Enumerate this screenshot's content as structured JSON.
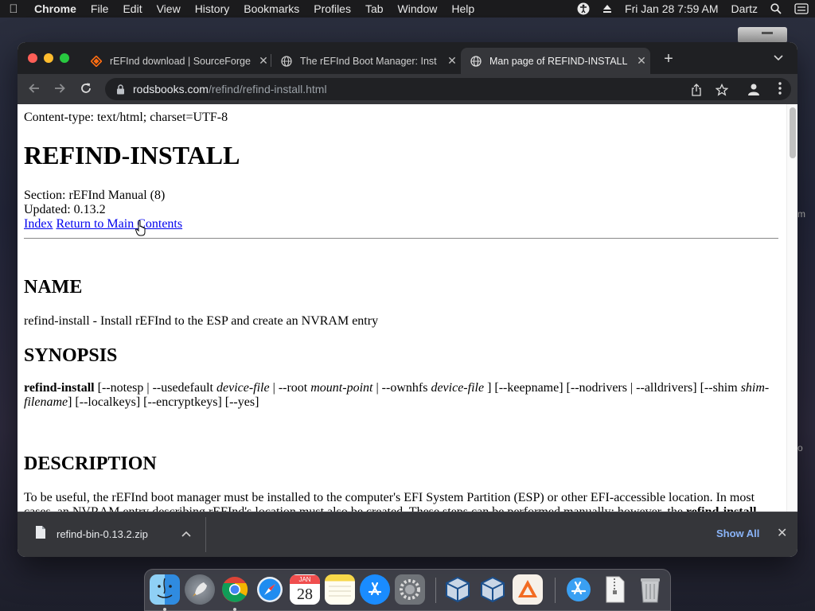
{
  "menubar": {
    "app_name": "Chrome",
    "items": [
      "File",
      "Edit",
      "View",
      "History",
      "Bookmarks",
      "Profiles",
      "Tab",
      "Window",
      "Help"
    ],
    "datetime": "Fri Jan 28  7:59 AM",
    "user": "Dartz"
  },
  "browser": {
    "tabs": [
      {
        "title": "rEFInd download | SourceForge",
        "active": false
      },
      {
        "title": "The rEFInd Boot Manager: Inst",
        "active": false
      },
      {
        "title": "Man page of REFIND-INSTALL",
        "active": true
      }
    ],
    "url_host": "rodsbooks.com",
    "url_path": "/refind/refind-install.html"
  },
  "page": {
    "content_type": "Content-type: text/html; charset=UTF-8",
    "title": "REFIND-INSTALL",
    "section": "Section: rEFInd Manual (8)",
    "updated": "Updated: 0.13.2",
    "links": {
      "index": "Index",
      "return": "Return to Main Contents"
    },
    "name_heading": "NAME",
    "name_text": "refind-install - Install rEFInd to the ESP and create an NVRAM entry",
    "synopsis_heading": "SYNOPSIS",
    "synopsis": {
      "command": "refind-install",
      "parts": [
        {
          "text": " [--notesp | --usedefault ",
          "italic": false
        },
        {
          "text": "device-file",
          "italic": true
        },
        {
          "text": " | --root ",
          "italic": false
        },
        {
          "text": "mount-point",
          "italic": true
        },
        {
          "text": " | --ownhfs ",
          "italic": false
        },
        {
          "text": "device-file",
          "italic": true
        },
        {
          "text": " ] [--keepname] [--nodrivers | --alldrivers] [--shim ",
          "italic": false
        },
        {
          "text": "shim-filename",
          "italic": true
        },
        {
          "text": "] [--localkeys] [--encryptkeys] [--yes]",
          "italic": false
        }
      ]
    },
    "description_heading": "DESCRIPTION",
    "description_text": "To be useful, the rEFInd boot manager must be installed to the computer's EFI System Partition (ESP) or other EFI-accessible location. In most cases, an NVRAM entry describing rEFInd's location must also be created. These steps can be performed manually; however, the ",
    "description_bold": "refind-install"
  },
  "downloads": {
    "filename": "refind-bin-0.13.2.zip",
    "show_all": "Show All"
  },
  "desktop": {
    "edge_fragment_1": "m",
    "edge_fragment_2": "o"
  },
  "dock": {
    "apps": [
      {
        "name": "Finder",
        "running": true
      },
      {
        "name": "Launchpad",
        "running": false
      },
      {
        "name": "Google Chrome",
        "running": true
      },
      {
        "name": "Safari",
        "running": false
      },
      {
        "name": "Calendar",
        "running": false,
        "month": "JAN",
        "day": "28"
      },
      {
        "name": "Notes",
        "running": false
      },
      {
        "name": "App Store",
        "running": false
      },
      {
        "name": "System Preferences",
        "running": false
      },
      {
        "name": "VirtualBox",
        "running": false
      },
      {
        "name": "VirtualBox VM",
        "running": false
      },
      {
        "name": "Sublime-like Editor",
        "running": false
      },
      {
        "name": "Applications Folder",
        "running": false
      },
      {
        "name": "Archive",
        "running": false
      },
      {
        "name": "Trash",
        "running": false
      }
    ]
  },
  "colors": {
    "link": "#0000ee",
    "show_all": "#8ab4f8",
    "tabstrip": "#1f2023",
    "toolbar": "#35363a"
  }
}
